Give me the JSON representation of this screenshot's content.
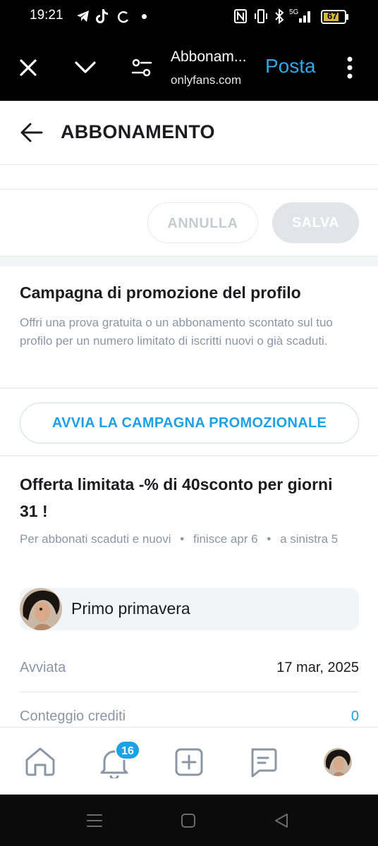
{
  "status_bar": {
    "time": "19:21",
    "battery": "67",
    "network": "5G"
  },
  "browser": {
    "tab_title": "Abbonam...",
    "domain": "onlyfans.com",
    "action_link": "Posta"
  },
  "header": {
    "title": "ABBONAMENTO"
  },
  "form_actions": {
    "cancel_label": "ANNULLA",
    "save_label": "SALVA"
  },
  "promo": {
    "title": "Campagna di promozione del profilo",
    "description": "Offri una prova gratuita o un abbonamento scontato sul tuo profilo per un numero limitato di iscritti nuovi o già scaduti.",
    "button_label": "AVVIA LA CAMPAGNA PROMOZIONALE"
  },
  "offer": {
    "title": "Offerta limitata -% di 40sconto per giorni 31 !",
    "audience": "Per abbonati scaduti e nuovi",
    "ends": "finisce apr 6",
    "left": "a sinistra 5",
    "profile_name": "Primo primavera",
    "rows": [
      {
        "label": "Avviata",
        "value": "17 mar, 2025"
      },
      {
        "label": "Conteggio crediti",
        "value": "0"
      }
    ]
  },
  "bottom_nav": {
    "notification_count": "16"
  },
  "colors": {
    "accent": "#1da1e6",
    "text": "#1c1c1e",
    "muted": "#8a96a3",
    "link": "#2ea8e6"
  }
}
